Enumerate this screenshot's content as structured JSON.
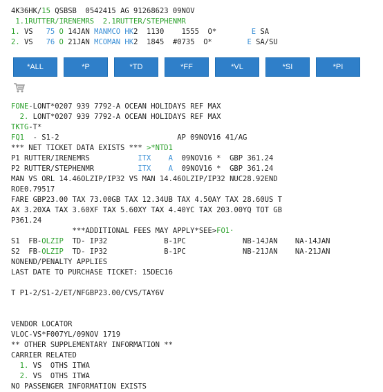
{
  "pnr_header": {
    "record_locator": "4K36HK",
    "slash": "/",
    "agent_num": "15",
    "pcc": " QSBSB  0542415 AG 91268623 09NOV"
  },
  "passengers": {
    "p1_num": "1.1",
    "p1_name": "RUTTER/IRENEMRS  ",
    "p2_num": "2.1",
    "p2_name": "RUTTER/STEPHENMR"
  },
  "segments": [
    {
      "num": "1.",
      "airline": " VS  ",
      "flight": " 75",
      "class": " O",
      "date": " 14JAN ",
      "route": "MANMCO",
      "sp": " ",
      "status": "HK",
      "rest": "2  1130    1555  O*        ",
      "e": "E",
      "tail": " SA"
    },
    {
      "num": "2.",
      "airline": " VS  ",
      "flight": " 76",
      "class": " O",
      "date": " 21JAN ",
      "route": "MCOMAN",
      "sp": " ",
      "status": "HK",
      "rest": "2  1845  #0735  O*        ",
      "e": "E",
      "tail": " SA/SU"
    }
  ],
  "buttons": [
    "*ALL",
    "*P",
    "*TD",
    "*FF",
    "*VL",
    "*SI",
    "*PI"
  ],
  "icons": {
    "cart": "shopping-cart"
  },
  "phone": {
    "label": "FONE",
    "line1": "-LONT*0207 939 7792-A OCEAN HOLIDAYS REF MAX",
    "line2_num": "  2.",
    "line2": " LONT*0207 939 7792-A OCEAN HOLIDAYS REF MAX"
  },
  "ticketing": {
    "label": "TKTG",
    "value": "-T*"
  },
  "fq": {
    "label": "FQ1",
    "line": "  - S1-2                           AP 09NOV16 41/AG",
    "net_text": "*** NET TICKET DATA EXISTS *** ",
    "net_link": ">*NTD1",
    "p1_pre": "P1 RUTTER/IRENEMRS           ",
    "p1_itx": "ITX",
    "p1_sp": "    ",
    "p1_a": "A",
    "p1_post": "  09NOV16 *  GBP 361.24",
    "p2_pre": "P2 RUTTER/STEPHENMR          ",
    "p2_itx": "ITX",
    "p2_sp": "    ",
    "p2_a": "A",
    "p2_post": "  09NOV16 *  GBP 361.24",
    "fare_lines": [
      "MAN VS ORL 14.46OLZIP/IP32 VS MAN 14.46OLZIP/IP32 NUC28.92END",
      "ROE0.79517",
      "FARE GBP23.00 TAX 73.00GB TAX 12.34UB TAX 4.50AY TAX 28.60US T",
      "AX 3.20XA TAX 3.60XF TAX 5.60XY TAX 4.40YC TAX 203.00YQ TOT GB",
      "P361.24"
    ],
    "fees_pre": "              ***ADDITIONAL FEES MAY APPLY*SEE>",
    "fees_link": "FO1·",
    "s1_pre": "S1  FB-",
    "s1_fb": "OLZIP",
    "s1_post": "  TD- IP32             B-1PC             NB-14JAN    NA-14JAN",
    "s2_pre": "S2  FB-",
    "s2_fb": "OLZIP",
    "s2_post": "  TD- IP32             B-1PC             NB-21JAN    NA-21JAN",
    "nonend": "NONEND/PENALTY APPLIES",
    "last_date": "LAST DATE TO PURCHASE TICKET: 15DEC16"
  },
  "ticket_line": "T P1-2/S1-2/ET/NFGBP23.00/CVS/TAY6V",
  "vendor": {
    "title": "VENDOR LOCATOR",
    "line": "VLOC-VS*F007YL/09NOV 1719"
  },
  "osi": {
    "title": "** OTHER SUPPLEMENTARY INFORMATION **",
    "carrier": "CARRIER RELATED",
    "items": [
      {
        "num": "  1.",
        "text": " VS  OTHS ITWA"
      },
      {
        "num": "  2.",
        "text": " VS  OTHS ITWA"
      }
    ]
  },
  "footer": "NO PASSENGER INFORMATION EXISTS",
  "colors": {
    "green": "#2aa02a",
    "blue": "#3a8fd6",
    "button": "#2f7fc9"
  }
}
